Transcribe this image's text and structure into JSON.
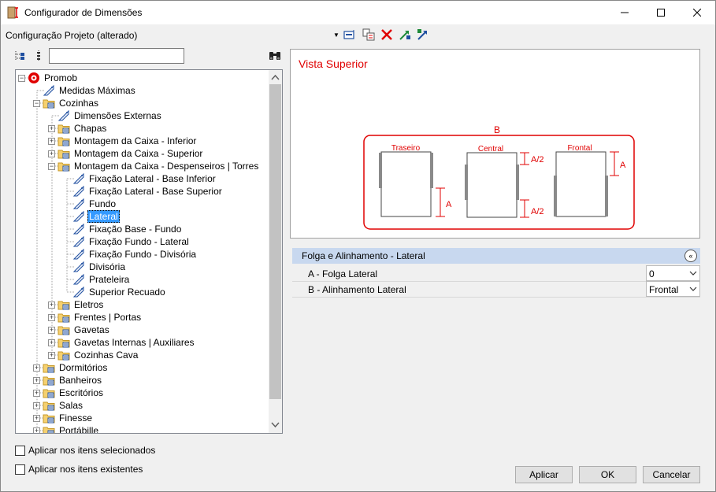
{
  "window": {
    "title": "Configurador de Dimensões",
    "accent": "#e00000"
  },
  "toolbar": {
    "configuration_label": "Configuração Projeto (alterado)",
    "icons": [
      "edit-icon",
      "copy-icon",
      "delete-icon",
      "import-icon",
      "export-icon"
    ]
  },
  "search": {
    "placeholder": "",
    "value": ""
  },
  "tree": {
    "items": [
      {
        "label": "Promob",
        "level": 0,
        "expander": "minus",
        "icon": "promob-logo-icon"
      },
      {
        "label": "Medidas Máximas",
        "level": 1,
        "expander": "none",
        "icon": "tag-icon"
      },
      {
        "label": "Cozinhas",
        "level": 1,
        "expander": "minus",
        "icon": "folder-icon"
      },
      {
        "label": "Dimensões Externas",
        "level": 2,
        "expander": "none",
        "icon": "tag-icon"
      },
      {
        "label": "Chapas",
        "level": 2,
        "expander": "plus",
        "icon": "folder-icon"
      },
      {
        "label": "Montagem da Caixa - Inferior",
        "level": 2,
        "expander": "plus",
        "icon": "folder-icon"
      },
      {
        "label": "Montagem da Caixa - Superior",
        "level": 2,
        "expander": "plus",
        "icon": "folder-icon"
      },
      {
        "label": "Montagem da Caixa - Despenseiros | Torres",
        "level": 2,
        "expander": "minus",
        "icon": "folder-icon"
      },
      {
        "label": "Fixação Lateral - Base Inferior",
        "level": 3,
        "expander": "none",
        "icon": "tag-icon"
      },
      {
        "label": "Fixação Lateral - Base Superior",
        "level": 3,
        "expander": "none",
        "icon": "tag-icon"
      },
      {
        "label": "Fundo",
        "level": 3,
        "expander": "none",
        "icon": "tag-icon"
      },
      {
        "label": "Lateral",
        "level": 3,
        "expander": "none",
        "icon": "tag-icon",
        "selected": true
      },
      {
        "label": "Fixação Base - Fundo",
        "level": 3,
        "expander": "none",
        "icon": "tag-icon"
      },
      {
        "label": "Fixação Fundo - Lateral",
        "level": 3,
        "expander": "none",
        "icon": "tag-icon"
      },
      {
        "label": "Fixação Fundo - Divisória",
        "level": 3,
        "expander": "none",
        "icon": "tag-icon"
      },
      {
        "label": "Divisória",
        "level": 3,
        "expander": "none",
        "icon": "tag-icon"
      },
      {
        "label": "Prateleira",
        "level": 3,
        "expander": "none",
        "icon": "tag-icon"
      },
      {
        "label": "Superior Recuado",
        "level": 3,
        "expander": "none",
        "icon": "tag-icon"
      },
      {
        "label": "Eletros",
        "level": 2,
        "expander": "plus",
        "icon": "folder-icon"
      },
      {
        "label": "Frentes | Portas",
        "level": 2,
        "expander": "plus",
        "icon": "folder-icon"
      },
      {
        "label": "Gavetas",
        "level": 2,
        "expander": "plus",
        "icon": "folder-icon"
      },
      {
        "label": "Gavetas Internas | Auxiliares",
        "level": 2,
        "expander": "plus",
        "icon": "folder-icon"
      },
      {
        "label": "Cozinhas Cava",
        "level": 2,
        "expander": "plus",
        "icon": "folder-icon"
      },
      {
        "label": "Dormitórios",
        "level": 1,
        "expander": "plus",
        "icon": "folder-icon"
      },
      {
        "label": "Banheiros",
        "level": 1,
        "expander": "plus",
        "icon": "folder-icon"
      },
      {
        "label": "Escritórios",
        "level": 1,
        "expander": "plus",
        "icon": "folder-icon"
      },
      {
        "label": "Salas",
        "level": 1,
        "expander": "plus",
        "icon": "folder-icon"
      },
      {
        "label": "Finesse",
        "level": 1,
        "expander": "plus",
        "icon": "folder-icon"
      },
      {
        "label": "Portábille",
        "level": 1,
        "expander": "plus",
        "icon": "folder-icon"
      }
    ]
  },
  "options": {
    "apply_selected": "Aplicar nos itens selecionados",
    "apply_existing": "Aplicar nos itens existentes"
  },
  "preview": {
    "title": "Vista Superior",
    "label_b": "B",
    "views": [
      {
        "label": "Traseiro",
        "dim": "A"
      },
      {
        "label": "Central",
        "dim_top": "A/2",
        "dim_bottom": "A/2"
      },
      {
        "label": "Frontal",
        "dim": "A"
      }
    ]
  },
  "properties": {
    "group_title": "Folga e Alinhamento -  Lateral",
    "rows": [
      {
        "name": "A - Folga Lateral",
        "value": "0"
      },
      {
        "name": "B - Alinhamento Lateral",
        "value": "Frontal"
      }
    ]
  },
  "buttons": {
    "apply": "Aplicar",
    "ok": "OK",
    "cancel": "Cancelar"
  }
}
